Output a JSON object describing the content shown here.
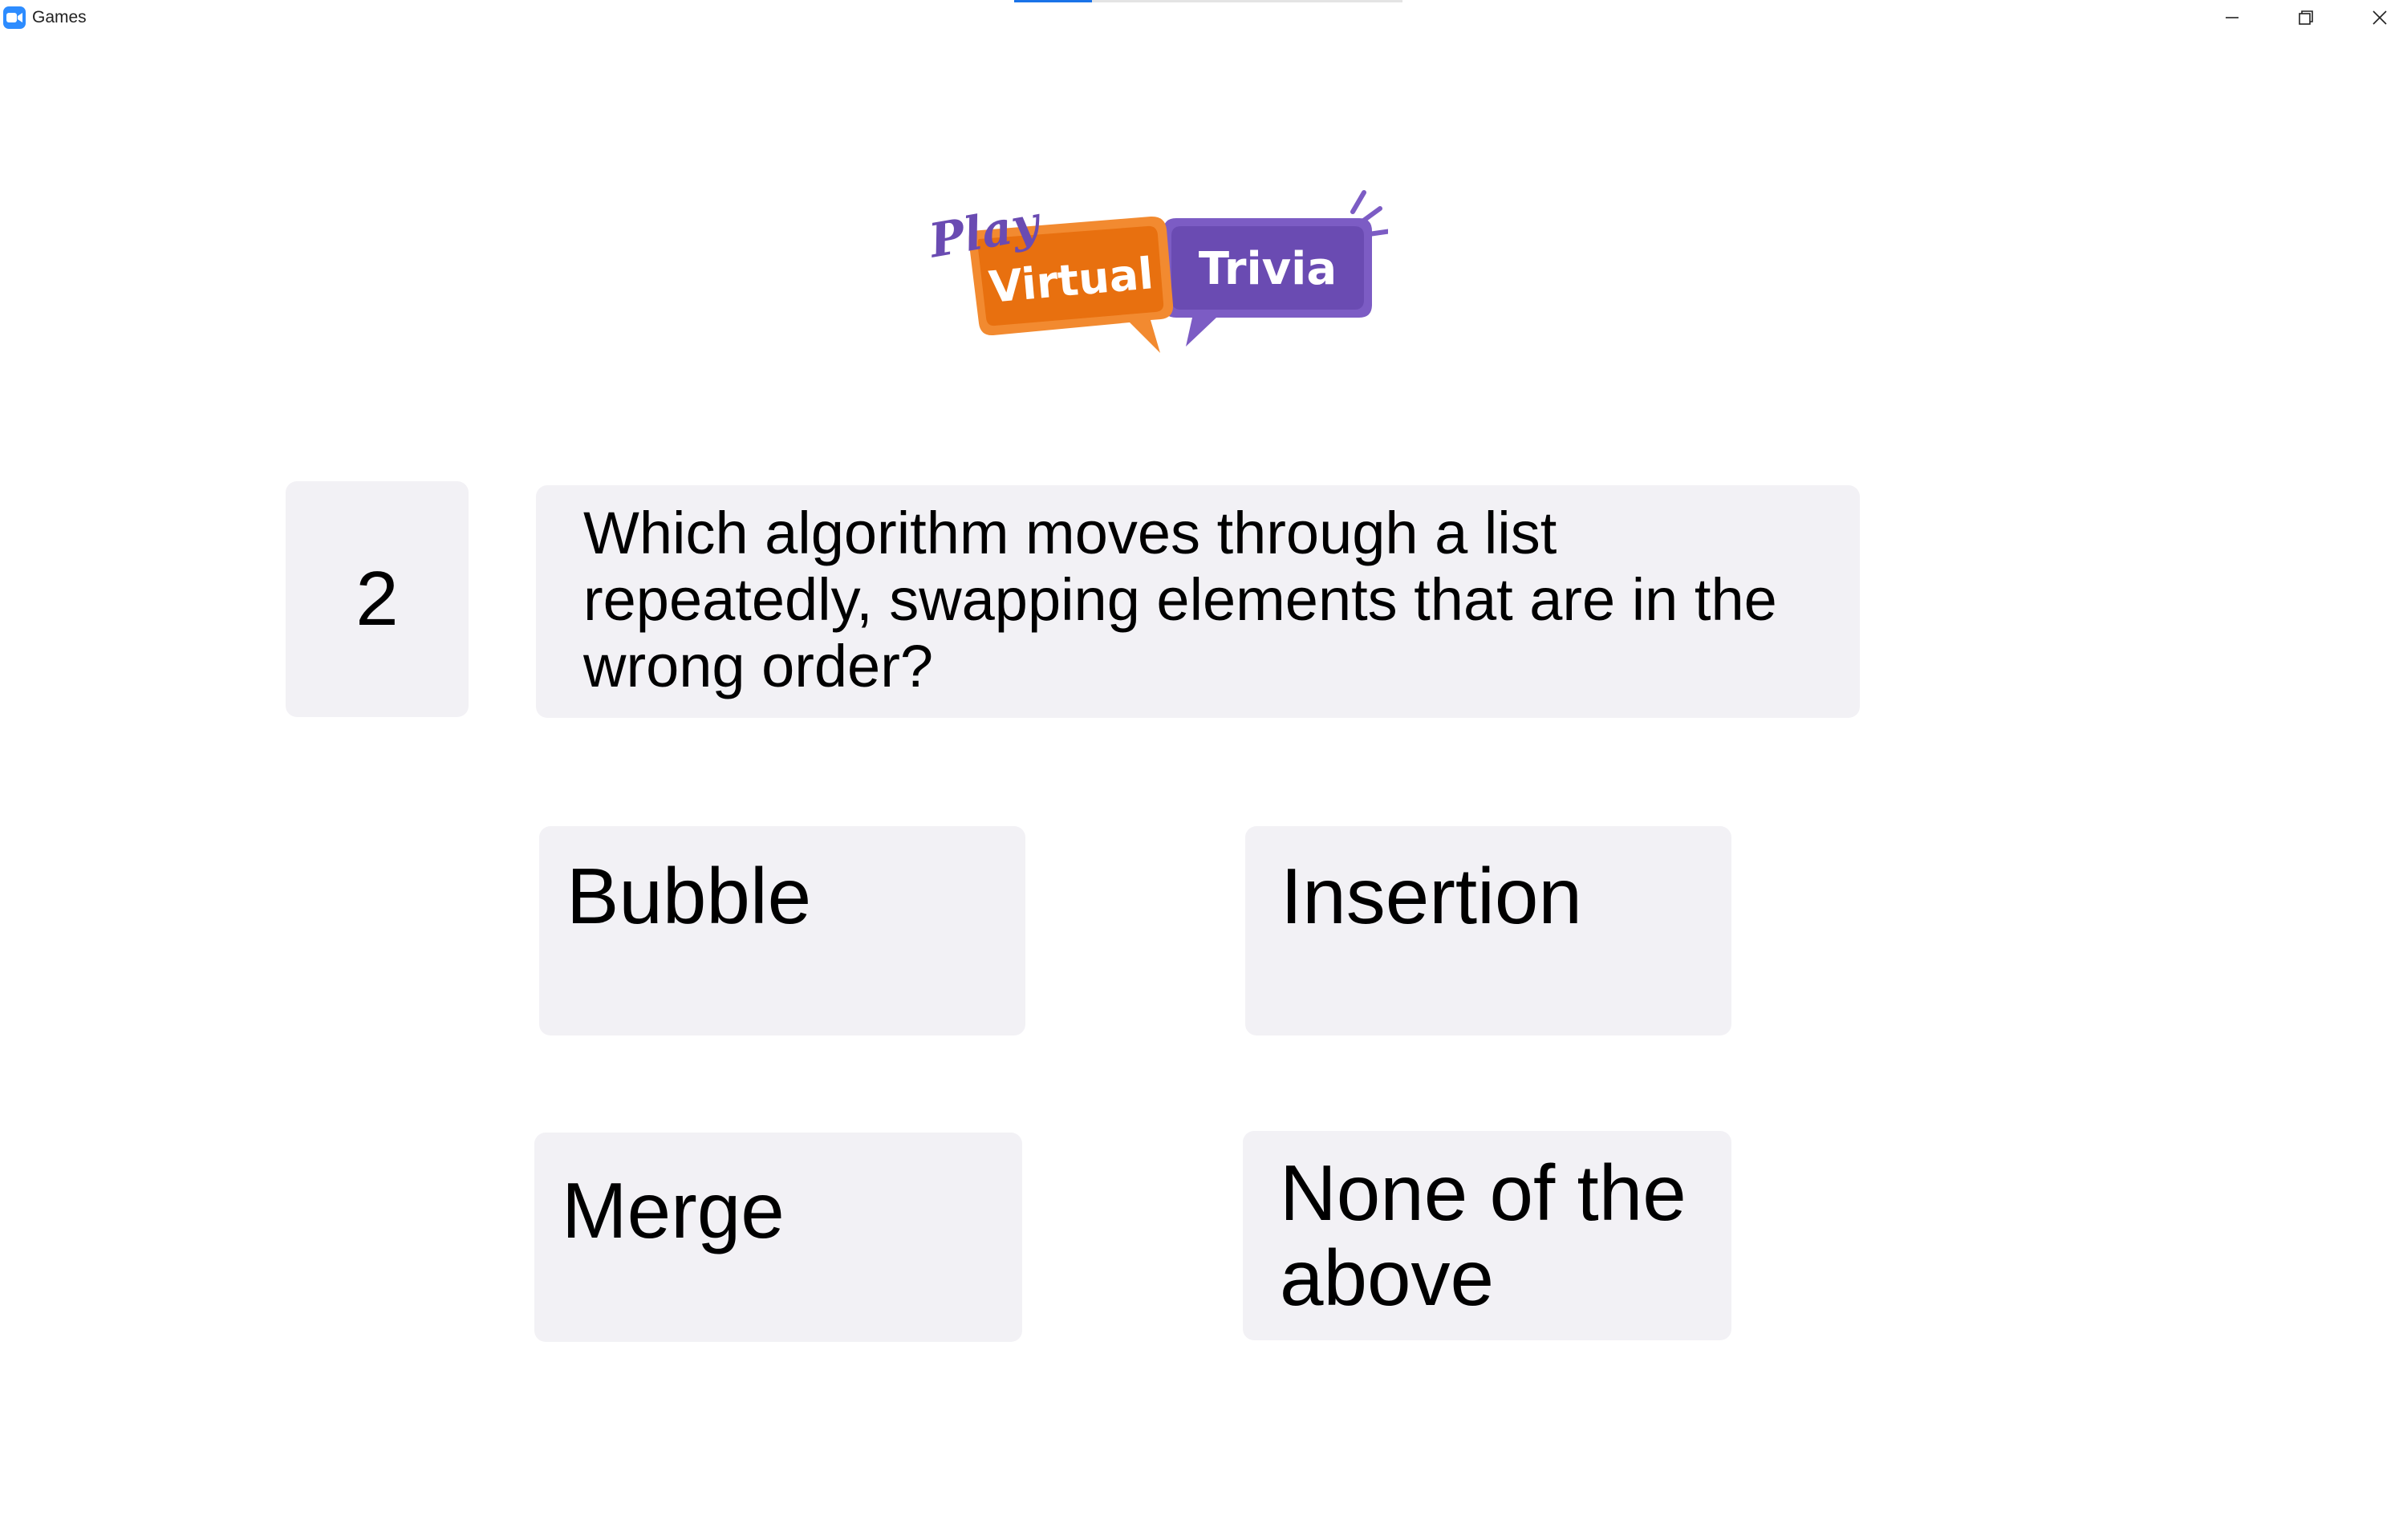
{
  "window": {
    "title": "Games",
    "app_icon": "zoom-camera-icon",
    "controls": [
      "minimize-icon",
      "restore-icon",
      "close-icon"
    ]
  },
  "top_progress": {
    "value": 0.2
  },
  "logo": {
    "word_play": "Play",
    "word_virtual": "Virtual",
    "word_trivia": "Trivia",
    "colors": {
      "orange": "#e8700f",
      "purple": "#6a4bb2"
    }
  },
  "question": {
    "number": "2",
    "text": "Which algorithm moves through a list repeatedly, swapping elements that are in the wrong order?"
  },
  "answers": [
    {
      "label": "Bubble"
    },
    {
      "label": "Insertion"
    },
    {
      "label": "Merge"
    },
    {
      "label": "None of the above"
    }
  ],
  "colors": {
    "card_bg": "#f2f1f5",
    "accent_blue": "#1a73e8",
    "app_icon_bg": "#2d8cff"
  }
}
